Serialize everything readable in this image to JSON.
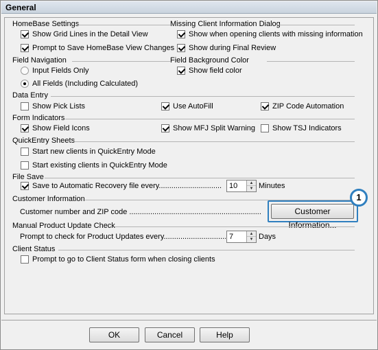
{
  "window": {
    "title": "General"
  },
  "homebase": {
    "title": "HomeBase Settings",
    "show_grid_lines": "Show Grid Lines in the Detail View",
    "prompt_save": "Prompt to Save HomeBase View Changes"
  },
  "missing_client": {
    "title": "Missing Client Information Dialog",
    "show_opening": "Show when opening clients with missing information",
    "show_final_review": "Show during Final Review"
  },
  "field_nav": {
    "title": "Field Navigation",
    "input_only": "Input Fields Only",
    "all_fields": "All Fields (Including Calculated)"
  },
  "field_bg": {
    "title": "Field Background Color",
    "show_color": "Show field color"
  },
  "data_entry": {
    "title": "Data Entry",
    "pick_lists": "Show Pick Lists",
    "autofill": "Use AutoFill",
    "zip_automation": "ZIP Code Automation"
  },
  "form_indicators": {
    "title": "Form Indicators",
    "field_icons": "Show Field Icons",
    "mfj_warning": "Show MFJ Split Warning",
    "tsj_indicators": "Show TSJ Indicators"
  },
  "quickentry": {
    "title": "QuickEntry Sheets",
    "new_clients": "Start new clients in QuickEntry Mode",
    "existing_clients": "Start existing clients in QuickEntry Mode"
  },
  "file_save": {
    "title": "File Save",
    "auto_recovery": "Save to Automatic Recovery file every..............................",
    "minutes_value": "10",
    "minutes_label": "Minutes"
  },
  "customer_info": {
    "title": "Customer Information",
    "label": "Customer number and ZIP code .................................................................",
    "button": "Customer Information...",
    "callout": "1"
  },
  "update_check": {
    "title": "Manual Product Update Check",
    "prompt": "Prompt to check for Product Updates every..............................",
    "days_value": "7",
    "days_label": "Days"
  },
  "client_status": {
    "title": "Client Status",
    "prompt": "Prompt to go to Client Status form when closing clients"
  },
  "footer": {
    "ok": "OK",
    "cancel": "Cancel",
    "help": "Help"
  },
  "colors": {
    "highlight": "#2f7fbf"
  }
}
